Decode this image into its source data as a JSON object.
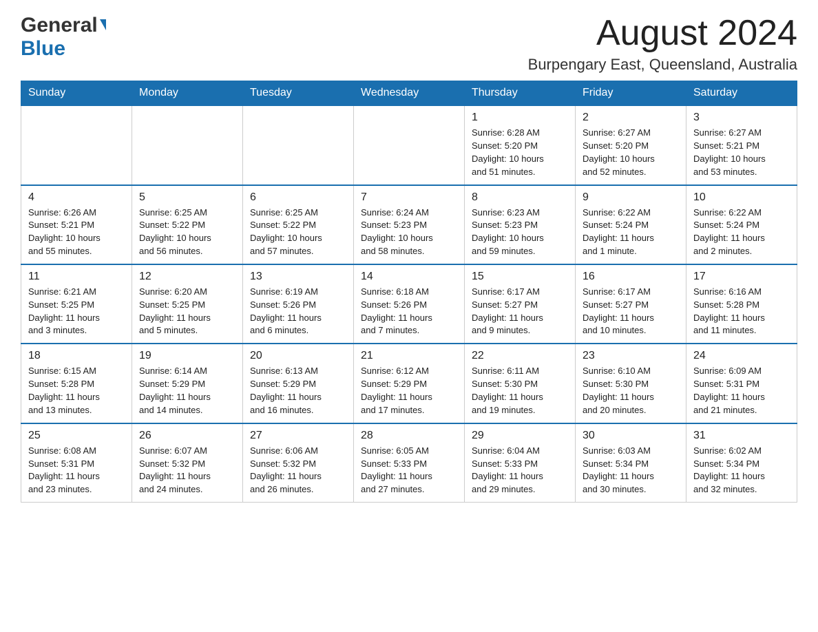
{
  "header": {
    "logo_general": "General",
    "logo_blue": "Blue",
    "month_year": "August 2024",
    "location": "Burpengary East, Queensland, Australia"
  },
  "weekdays": [
    "Sunday",
    "Monday",
    "Tuesday",
    "Wednesday",
    "Thursday",
    "Friday",
    "Saturday"
  ],
  "weeks": [
    [
      {
        "day": "",
        "info": ""
      },
      {
        "day": "",
        "info": ""
      },
      {
        "day": "",
        "info": ""
      },
      {
        "day": "",
        "info": ""
      },
      {
        "day": "1",
        "info": "Sunrise: 6:28 AM\nSunset: 5:20 PM\nDaylight: 10 hours\nand 51 minutes."
      },
      {
        "day": "2",
        "info": "Sunrise: 6:27 AM\nSunset: 5:20 PM\nDaylight: 10 hours\nand 52 minutes."
      },
      {
        "day": "3",
        "info": "Sunrise: 6:27 AM\nSunset: 5:21 PM\nDaylight: 10 hours\nand 53 minutes."
      }
    ],
    [
      {
        "day": "4",
        "info": "Sunrise: 6:26 AM\nSunset: 5:21 PM\nDaylight: 10 hours\nand 55 minutes."
      },
      {
        "day": "5",
        "info": "Sunrise: 6:25 AM\nSunset: 5:22 PM\nDaylight: 10 hours\nand 56 minutes."
      },
      {
        "day": "6",
        "info": "Sunrise: 6:25 AM\nSunset: 5:22 PM\nDaylight: 10 hours\nand 57 minutes."
      },
      {
        "day": "7",
        "info": "Sunrise: 6:24 AM\nSunset: 5:23 PM\nDaylight: 10 hours\nand 58 minutes."
      },
      {
        "day": "8",
        "info": "Sunrise: 6:23 AM\nSunset: 5:23 PM\nDaylight: 10 hours\nand 59 minutes."
      },
      {
        "day": "9",
        "info": "Sunrise: 6:22 AM\nSunset: 5:24 PM\nDaylight: 11 hours\nand 1 minute."
      },
      {
        "day": "10",
        "info": "Sunrise: 6:22 AM\nSunset: 5:24 PM\nDaylight: 11 hours\nand 2 minutes."
      }
    ],
    [
      {
        "day": "11",
        "info": "Sunrise: 6:21 AM\nSunset: 5:25 PM\nDaylight: 11 hours\nand 3 minutes."
      },
      {
        "day": "12",
        "info": "Sunrise: 6:20 AM\nSunset: 5:25 PM\nDaylight: 11 hours\nand 5 minutes."
      },
      {
        "day": "13",
        "info": "Sunrise: 6:19 AM\nSunset: 5:26 PM\nDaylight: 11 hours\nand 6 minutes."
      },
      {
        "day": "14",
        "info": "Sunrise: 6:18 AM\nSunset: 5:26 PM\nDaylight: 11 hours\nand 7 minutes."
      },
      {
        "day": "15",
        "info": "Sunrise: 6:17 AM\nSunset: 5:27 PM\nDaylight: 11 hours\nand 9 minutes."
      },
      {
        "day": "16",
        "info": "Sunrise: 6:17 AM\nSunset: 5:27 PM\nDaylight: 11 hours\nand 10 minutes."
      },
      {
        "day": "17",
        "info": "Sunrise: 6:16 AM\nSunset: 5:28 PM\nDaylight: 11 hours\nand 11 minutes."
      }
    ],
    [
      {
        "day": "18",
        "info": "Sunrise: 6:15 AM\nSunset: 5:28 PM\nDaylight: 11 hours\nand 13 minutes."
      },
      {
        "day": "19",
        "info": "Sunrise: 6:14 AM\nSunset: 5:29 PM\nDaylight: 11 hours\nand 14 minutes."
      },
      {
        "day": "20",
        "info": "Sunrise: 6:13 AM\nSunset: 5:29 PM\nDaylight: 11 hours\nand 16 minutes."
      },
      {
        "day": "21",
        "info": "Sunrise: 6:12 AM\nSunset: 5:29 PM\nDaylight: 11 hours\nand 17 minutes."
      },
      {
        "day": "22",
        "info": "Sunrise: 6:11 AM\nSunset: 5:30 PM\nDaylight: 11 hours\nand 19 minutes."
      },
      {
        "day": "23",
        "info": "Sunrise: 6:10 AM\nSunset: 5:30 PM\nDaylight: 11 hours\nand 20 minutes."
      },
      {
        "day": "24",
        "info": "Sunrise: 6:09 AM\nSunset: 5:31 PM\nDaylight: 11 hours\nand 21 minutes."
      }
    ],
    [
      {
        "day": "25",
        "info": "Sunrise: 6:08 AM\nSunset: 5:31 PM\nDaylight: 11 hours\nand 23 minutes."
      },
      {
        "day": "26",
        "info": "Sunrise: 6:07 AM\nSunset: 5:32 PM\nDaylight: 11 hours\nand 24 minutes."
      },
      {
        "day": "27",
        "info": "Sunrise: 6:06 AM\nSunset: 5:32 PM\nDaylight: 11 hours\nand 26 minutes."
      },
      {
        "day": "28",
        "info": "Sunrise: 6:05 AM\nSunset: 5:33 PM\nDaylight: 11 hours\nand 27 minutes."
      },
      {
        "day": "29",
        "info": "Sunrise: 6:04 AM\nSunset: 5:33 PM\nDaylight: 11 hours\nand 29 minutes."
      },
      {
        "day": "30",
        "info": "Sunrise: 6:03 AM\nSunset: 5:34 PM\nDaylight: 11 hours\nand 30 minutes."
      },
      {
        "day": "31",
        "info": "Sunrise: 6:02 AM\nSunset: 5:34 PM\nDaylight: 11 hours\nand 32 minutes."
      }
    ]
  ]
}
